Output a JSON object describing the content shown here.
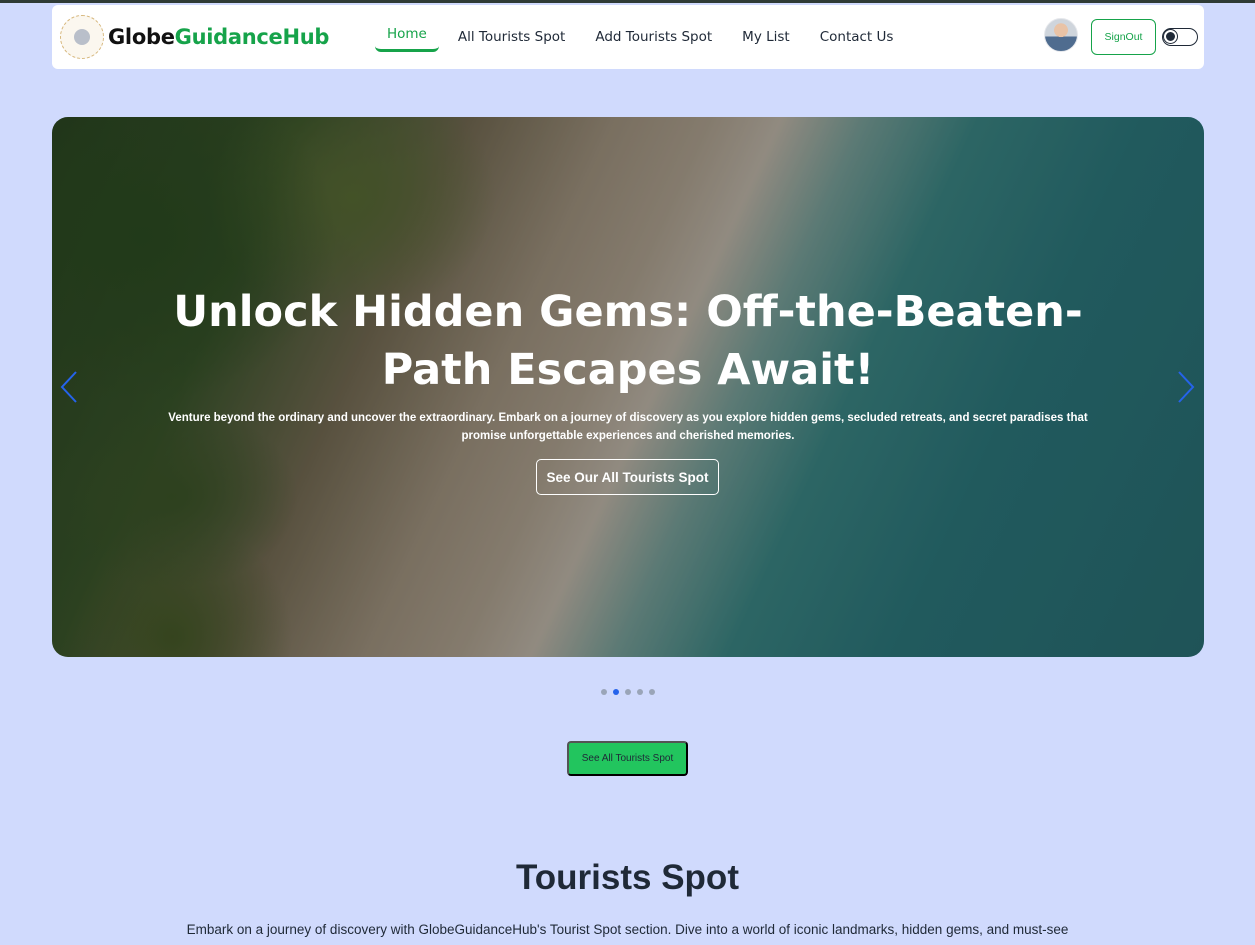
{
  "brand": {
    "name_part1": "Globe",
    "name_part2": "GuidanceHub"
  },
  "nav": {
    "links": [
      {
        "label": "Home",
        "active": true
      },
      {
        "label": "All Tourists Spot"
      },
      {
        "label": "Add Tourists Spot"
      },
      {
        "label": "My List"
      },
      {
        "label": "Contact Us"
      }
    ],
    "signout_label": "SignOut"
  },
  "hero": {
    "title": "Unlock Hidden Gems: Off-the-Beaten-Path Escapes Await!",
    "subtitle": "Venture beyond the ordinary and uncover the extraordinary. Embark on a journey of discovery as you explore hidden gems, secluded retreats, and secret paradises that promise unforgettable experiences and cherished memories.",
    "button_label": "See Our All Tourists Spot",
    "slides_count": 5,
    "active_slide": 2
  },
  "cta": {
    "label": "See All Tourists Spot"
  },
  "section": {
    "title": "Tourists Spot",
    "text": "Embark on a journey of discovery with GlobeGuidanceHub's Tourist Spot section. Dive into a world of iconic landmarks, hidden gems, and must-see"
  },
  "colors": {
    "accent": "#16a34a",
    "cta_bg": "#22c55e",
    "page_bg": "#d0dafd",
    "carousel_arrow": "#2563eb"
  },
  "icons": {
    "prev": "chevron-left-icon",
    "next": "chevron-right-icon"
  }
}
